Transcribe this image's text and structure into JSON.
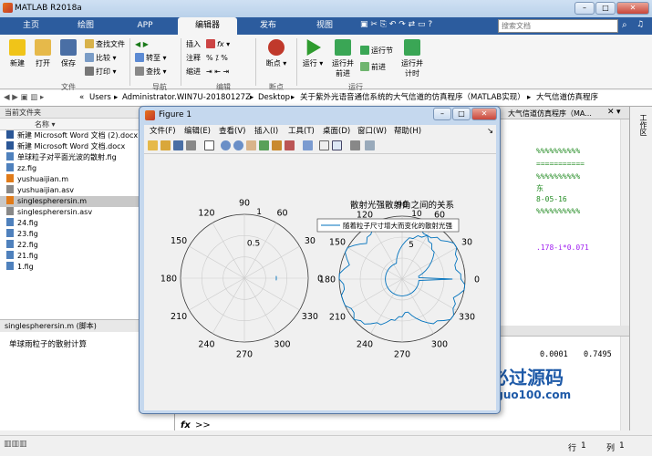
{
  "window": {
    "title": "MATLAB R2018a"
  },
  "ribbon_tabs": [
    "主页",
    "绘图",
    "APP",
    "编辑器",
    "发布",
    "视图"
  ],
  "search": {
    "placeholder": "搜索文档"
  },
  "ribbon": {
    "file_group": "文件",
    "nav_group": "导航",
    "edit_group": "编辑",
    "bp_group": "断点",
    "run_group": "运行",
    "new": "新建",
    "open": "打开",
    "save": "保存",
    "find_files": "查找文件",
    "compare": "比较",
    "print": "打印",
    "goto": "转至",
    "find": "查找",
    "insert": "插入",
    "comment": "注释",
    "indent": "缩进",
    "fx": "fx",
    "breakpoints": "断点",
    "run": "运行",
    "run_advance": "运行并\n前进",
    "run_section": "运行节",
    "advance": "前进",
    "run_time": "运行并\n计时"
  },
  "address": {
    "parts": [
      "«",
      "Users",
      "Administrator.WIN7U-20180127Z",
      "Desktop",
      "关于紫外光语音通信系统的大气信道的仿真程序（MATLAB实现）",
      "大气信道仿真程序"
    ]
  },
  "current_folder": {
    "title": "当前文件夹",
    "col_name": "名称",
    "files": [
      "新建 Microsoft Word 文档 (2).docx",
      "新建 Microsoft Word 文档.docx",
      "单球粒子对平面光波的散射.fig",
      "zz.fig",
      "yushuaijian.m",
      "yushuaijian.asv",
      "singlespherersin.m",
      "singlespherersin.asv",
      "24.fig",
      "23.fig",
      "22.fig",
      "21.fig",
      "1.fig"
    ],
    "selected_index": 6
  },
  "details": {
    "title": "singlespherersin.m  (脚本)",
    "desc": "单球雨粒子的散射计算"
  },
  "editor": {
    "tab": "大气信道仿真程序（MA...",
    "lines": [
      "%%%%%%%%%%",
      "===========",
      "%%%%%%%%%%",
      "东",
      "8-05-16",
      "%%%%%%%%%%",
      ".178-i*0.071"
    ]
  },
  "command": {
    "values": [
      "0.0001",
      "0.7495"
    ],
    "prompt": ">>",
    "fx": "fx"
  },
  "right_panel": {
    "label": "工作区"
  },
  "status": {
    "row_label": "行",
    "row": "1",
    "col_label": "列",
    "col": "1"
  },
  "figure": {
    "title": "Figure 1",
    "menu": [
      "文件(F)",
      "编辑(E)",
      "查看(V)",
      "插入(I)",
      "工具(T)",
      "桌面(D)",
      "窗口(W)",
      "帮助(H)"
    ]
  },
  "chart_data": [
    {
      "type": "polar",
      "title": "",
      "angle_labels": [
        "0",
        "30",
        "60",
        "90",
        "120",
        "150",
        "180",
        "210",
        "240",
        "270",
        "300",
        "330"
      ],
      "radial_ticks": [
        "0.5",
        "1"
      ],
      "series": [
        {
          "theta": [
            -4,
            -2,
            0,
            2,
            4
          ],
          "r": [
            1,
            1,
            1,
            1,
            1
          ]
        }
      ]
    },
    {
      "type": "polar",
      "title": "散射光强散射角之间的关系",
      "angle_labels": [
        "0",
        "30",
        "60",
        "90",
        "120",
        "150",
        "180",
        "210",
        "240",
        "270",
        "300",
        "330"
      ],
      "radial_ticks": [
        "5",
        "10"
      ],
      "legend": "随着粒子尺寸增大而变化的散射光强",
      "legend_position": "top",
      "series": [
        {
          "name": "随着粒子尺寸增大而变化的散射光强",
          "theta_step": 5,
          "r_max": 15,
          "r": [
            12,
            4,
            4,
            5,
            6,
            7,
            8,
            9,
            10,
            10,
            11,
            11,
            12,
            12,
            13,
            13,
            13,
            12,
            12,
            12,
            13,
            14,
            15,
            14,
            14,
            13,
            13,
            12,
            13,
            14,
            15,
            15,
            14,
            13,
            14,
            15,
            15,
            14,
            14,
            15,
            15,
            15,
            14,
            14,
            15,
            14,
            14,
            13,
            12,
            12,
            11,
            10,
            10,
            9,
            9,
            8,
            8,
            9,
            10,
            11,
            12,
            13,
            13,
            14,
            15,
            15,
            14,
            14,
            13,
            14,
            15,
            15,
            14,
            14,
            13,
            13,
            14,
            14,
            15,
            15,
            14,
            13,
            13,
            12,
            12,
            11,
            11,
            10,
            10,
            9,
            8,
            7,
            6,
            5,
            4,
            4,
            4,
            4,
            4,
            4,
            4,
            4,
            4,
            4,
            4,
            4,
            4,
            4,
            4,
            4,
            4,
            4,
            4,
            4,
            4,
            4,
            4,
            4,
            4,
            4,
            4,
            4,
            4,
            4,
            4,
            4,
            4,
            4,
            4,
            4,
            4,
            4,
            4,
            4,
            4,
            4,
            4,
            4,
            4,
            4,
            4,
            4,
            4,
            4
          ]
        }
      ]
    }
  ],
  "watermark": {
    "brand": "必过源码",
    "url": "Biguo100.com"
  }
}
